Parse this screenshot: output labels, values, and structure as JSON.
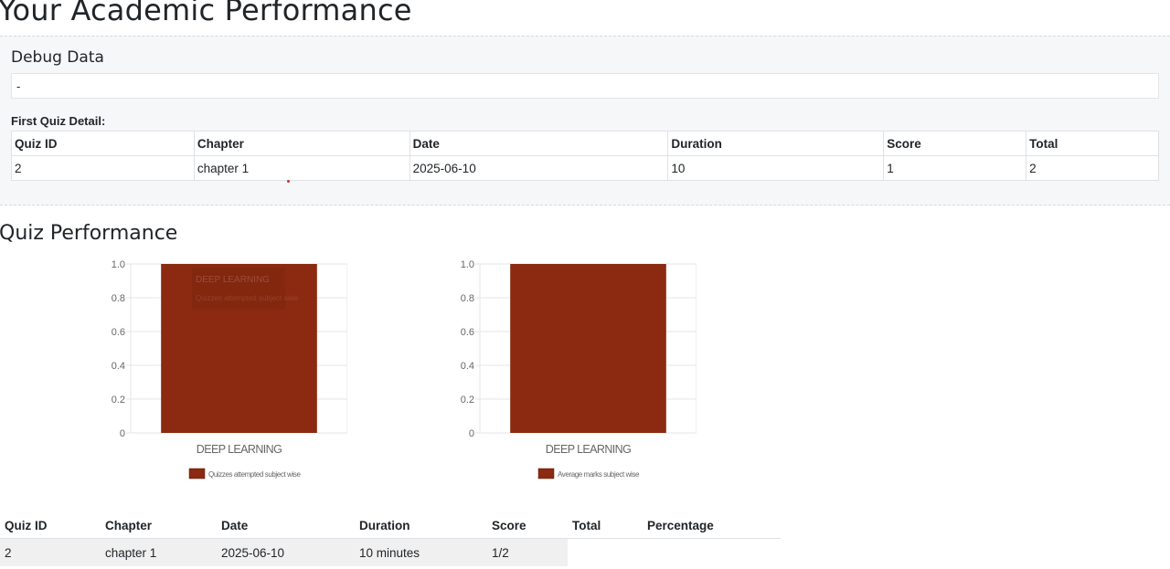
{
  "page": {
    "title": "Your Academic Performance"
  },
  "debug": {
    "heading": "Debug Data",
    "value": "-",
    "first_quiz_label": "First Quiz Detail:",
    "table": {
      "headers": [
        "Quiz ID",
        "Chapter",
        "Date",
        "Duration",
        "Score",
        "Total"
      ],
      "row": [
        "2",
        "chapter 1",
        "2025-06-10",
        "10",
        "1",
        "2"
      ]
    }
  },
  "quiz_performance": {
    "heading": "Quiz Performance"
  },
  "colors": {
    "bar": "#8b2a10",
    "grid": "#e6e6e6",
    "tick": "#666666"
  },
  "chart_data": [
    {
      "type": "bar",
      "categories": [
        "DEEP LEARNING"
      ],
      "series": [
        {
          "name": "Quizzes attempted subject wise",
          "values": [
            1
          ]
        }
      ],
      "ylim": [
        0,
        1.0
      ],
      "yticks": [
        "0",
        "0.2",
        "0.4",
        "0.6",
        "0.8",
        "1.0"
      ],
      "tooltip": [
        "DEEP LEARNING",
        "Quizzes attempted subject wise"
      ],
      "legend": "bottom",
      "grid": true
    },
    {
      "type": "bar",
      "categories": [
        "DEEP LEARNING"
      ],
      "series": [
        {
          "name": "Average marks subject wise",
          "values": [
            1
          ]
        }
      ],
      "ylim": [
        0,
        1.0
      ],
      "yticks": [
        "0",
        "0.2",
        "0.4",
        "0.6",
        "0.8",
        "1.0"
      ],
      "legend": "bottom",
      "grid": true
    }
  ],
  "performance_table": {
    "headers": [
      "Quiz ID",
      "Chapter",
      "Date",
      "Duration",
      "Score",
      "Total",
      "Percentage"
    ],
    "rows": [
      [
        "2",
        "chapter 1",
        "2025-06-10",
        "10 minutes",
        "1/2",
        "",
        ""
      ]
    ]
  }
}
